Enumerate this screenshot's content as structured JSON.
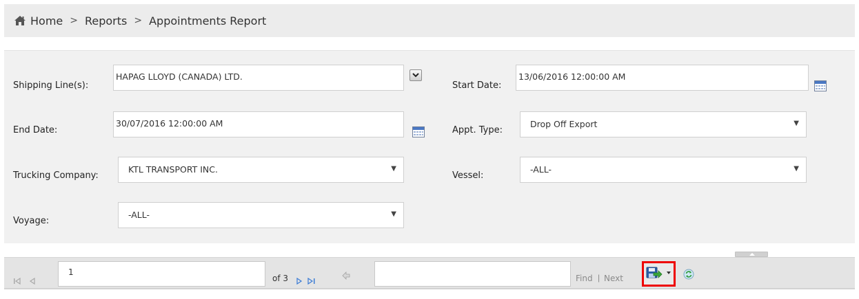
{
  "breadcrumb": {
    "items": [
      "Home",
      "Reports",
      "Appointments Report"
    ],
    "separator": ">"
  },
  "params": {
    "shipping_line": {
      "label": "Shipping Line(s):",
      "value": "HAPAG LLOYD (CANADA) LTD."
    },
    "start_date": {
      "label": "Start Date:",
      "value": "13/06/2016 12:00:00 AM"
    },
    "end_date": {
      "label": "End Date:",
      "value": "30/07/2016 12:00:00 AM"
    },
    "appt_type": {
      "label": "Appt. Type:",
      "value": "Drop Off Export"
    },
    "trucking_company": {
      "label": "Trucking Company:",
      "value": "KTL TRANSPORT INC."
    },
    "vessel": {
      "label": "Vessel:",
      "value": "-ALL-"
    },
    "voyage": {
      "label": "Voyage:",
      "value": "-ALL-"
    }
  },
  "toolbar": {
    "page_value": "1",
    "page_total_text": "of 3",
    "find_label": "Find",
    "find_separator": "|",
    "next_label": "Next"
  },
  "icons": {
    "home": "home-icon",
    "first_page": "first-page-icon",
    "prev_page": "previous-page-icon",
    "next_page": "next-page-icon",
    "last_page": "last-page-icon",
    "back": "back-icon",
    "export": "export-icon",
    "refresh": "refresh-icon",
    "calendar": "calendar-icon"
  },
  "colors": {
    "highlight": "#ee0000",
    "nav_blue": "#3a7bd5"
  }
}
